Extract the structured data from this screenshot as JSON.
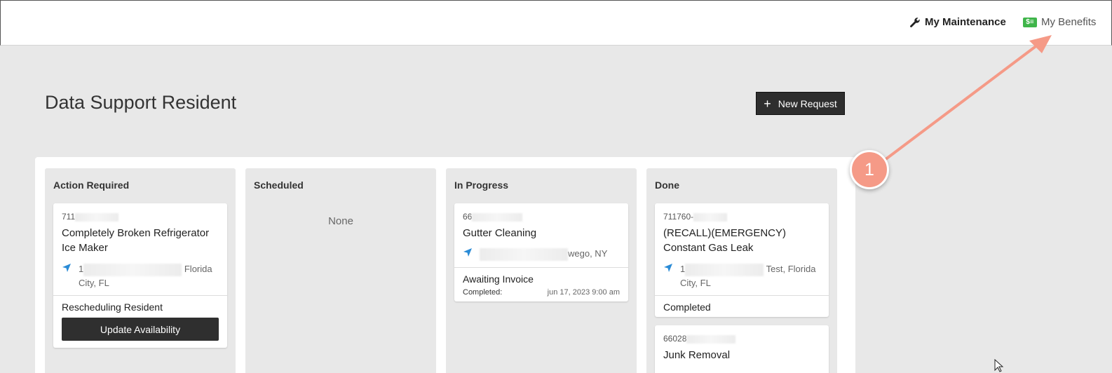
{
  "header": {
    "nav": [
      {
        "label": "My Maintenance",
        "icon": "wrench-icon"
      },
      {
        "label": "My Benefits",
        "icon": "money-icon"
      }
    ]
  },
  "page": {
    "title": "Data Support Resident",
    "new_request_label": "New Request"
  },
  "columns": [
    {
      "title": "Action Required",
      "cards": [
        {
          "id": "711",
          "title": "Completely Broken Refrigerator Ice Maker",
          "address_prefix": "1",
          "address_suffix": "Florida",
          "address_line2": "City, FL",
          "status": "Rescheduling Resident",
          "action_label": "Update Availability"
        }
      ]
    },
    {
      "title": "Scheduled",
      "empty_text": "None"
    },
    {
      "title": "In Progress",
      "cards": [
        {
          "id": "66",
          "title": "Gutter Cleaning",
          "address_suffix": "wego, NY",
          "status": "Awaiting Invoice",
          "completed_label": "Completed:",
          "completed_value": "jun 17, 2023 9:00 am"
        }
      ]
    },
    {
      "title": "Done",
      "cards": [
        {
          "id": "711760-",
          "title": "(RECALL)(EMERGENCY) Constant Gas Leak",
          "address_prefix": "1",
          "address_suffix": "Test, Florida",
          "address_line2": "City, FL",
          "status": "Completed"
        },
        {
          "id": "66028",
          "title": "Junk Removal"
        }
      ]
    }
  ],
  "annotation": {
    "number": "1",
    "color": "#f59a87"
  },
  "colors": {
    "accent_dark": "#2e2e2e",
    "pin_blue": "#2a8bd6",
    "benefits_green": "#3fb54a"
  }
}
